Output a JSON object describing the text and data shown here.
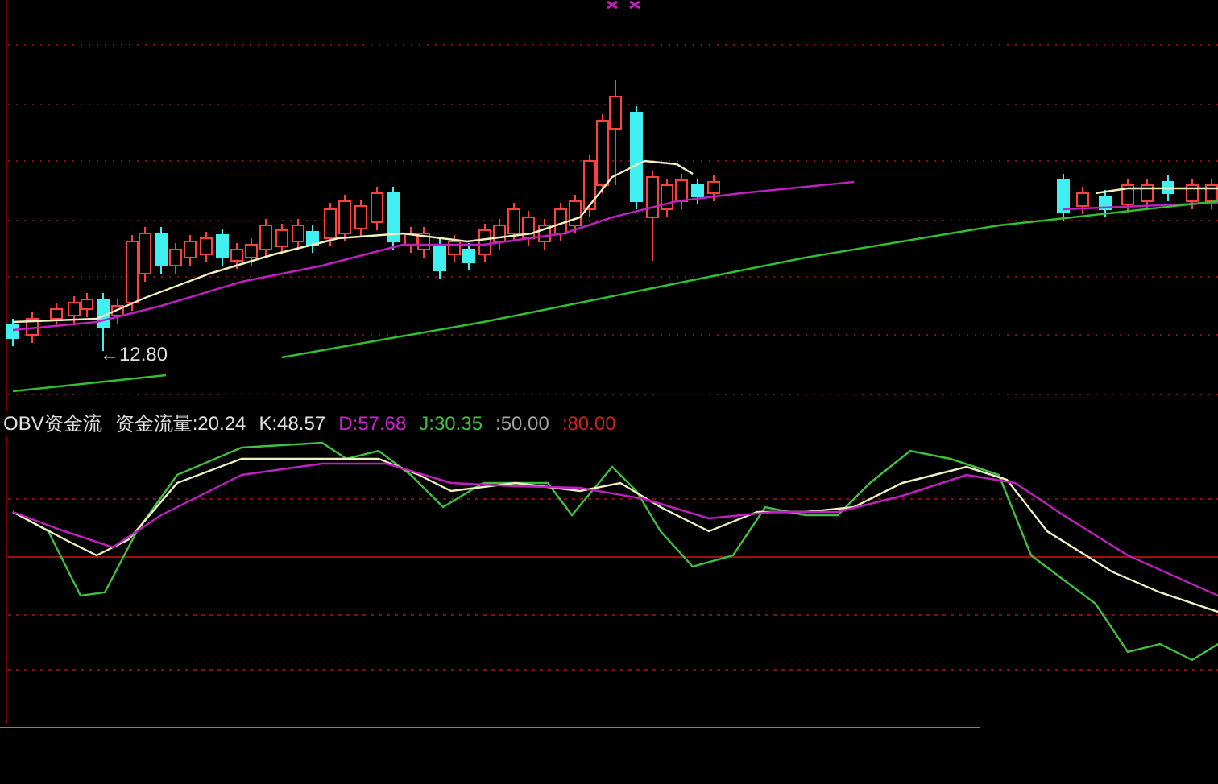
{
  "price_chart": {
    "low_label": "←12.80"
  },
  "indicator": {
    "name": "OBV资金流",
    "values": [
      {
        "text": "资金流量:20.24",
        "color": "#e0e0e0"
      },
      {
        "text": "K:48.57",
        "color": "#e0e0e0"
      },
      {
        "text": "D:57.68",
        "color": "#d020d0"
      },
      {
        "text": "J:30.35",
        "color": "#40c040"
      },
      {
        "text": ":50.00",
        "color": "#a0a0a0"
      },
      {
        "text": ":80.00",
        "color": "#d02020"
      }
    ]
  }
}
